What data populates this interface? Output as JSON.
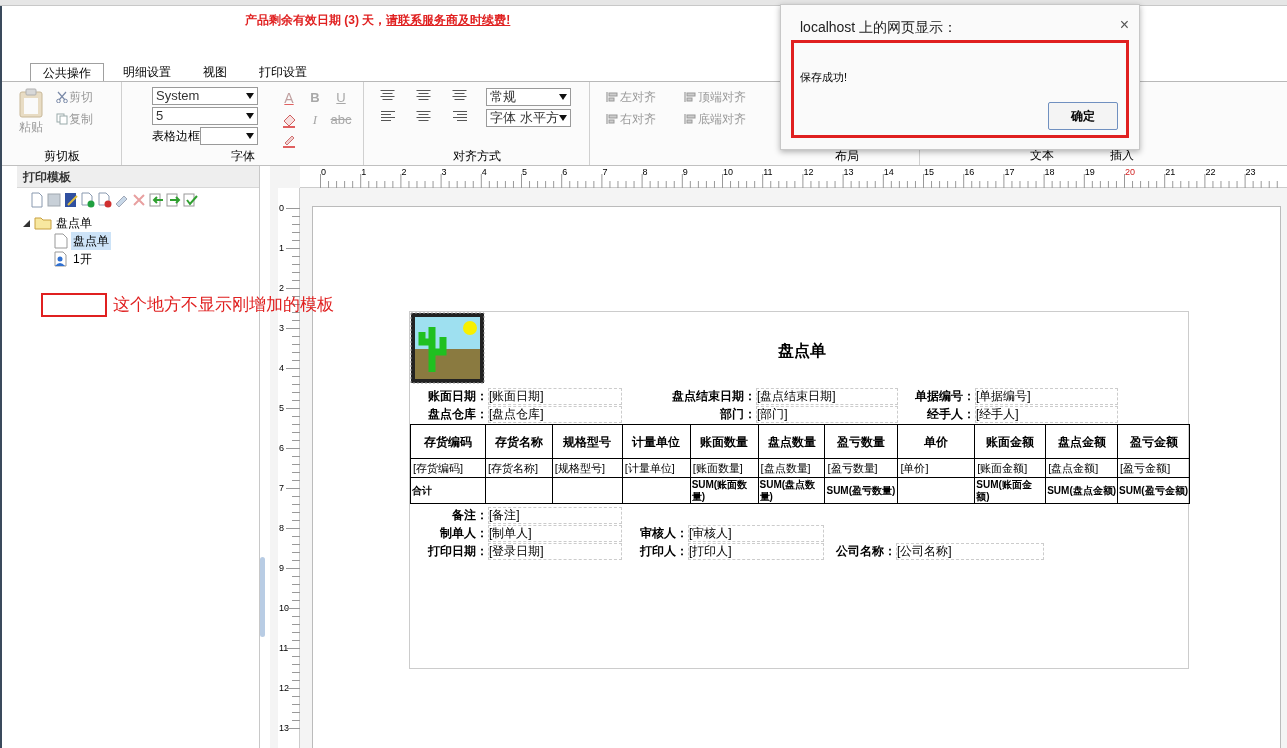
{
  "notice": {
    "text": "产品剩余有效日期 (3) 天，",
    "link": "请联系服务商及时续费!"
  },
  "ribbon": {
    "tabs": [
      {
        "label": "公共操作",
        "selected": true
      },
      {
        "label": "明细设置",
        "selected": false
      },
      {
        "label": "视图",
        "selected": false
      },
      {
        "label": "打印设置",
        "selected": false
      }
    ],
    "clipboard": {
      "label": "剪切板",
      "paste": {
        "label": "粘贴",
        "disabled": true
      },
      "buttons": [
        {
          "label": "剪切",
          "kind": "cut",
          "disabled": true
        },
        {
          "label": "复制",
          "kind": "copy",
          "disabled": true
        }
      ]
    },
    "font": {
      "label": "字体",
      "font_name": "System",
      "font_size": "5",
      "border_label": "表格边框",
      "style_buttons": [
        {
          "label": "B",
          "kind": "bold"
        },
        {
          "label": "U",
          "kind": "underline"
        },
        {
          "label": "I",
          "kind": "italic"
        },
        {
          "label": "abc",
          "kind": "strike"
        }
      ],
      "color_letter": "A"
    },
    "alignment": {
      "label": "对齐方式",
      "style": "常规",
      "direction": "字体 水平方"
    },
    "layout": {
      "label": "布局",
      "buttons": [
        {
          "label": "左对齐",
          "disabled": true
        },
        {
          "label": "顶端对齐",
          "disabled": true
        },
        {
          "label": "右对齐",
          "disabled": true
        },
        {
          "label": "底端对齐",
          "disabled": true
        }
      ]
    },
    "more_groups": [
      "文本",
      "插入"
    ]
  },
  "templates": {
    "title": "打印模板",
    "tree": [
      {
        "label": "盘点单",
        "expanded": true,
        "children": [
          {
            "label": "盘点单",
            "kind": "document",
            "selected": true
          },
          {
            "label": "1开",
            "kind": "user",
            "selected": false
          }
        ]
      }
    ]
  },
  "annotation": "这个地方不显示刚增加的模板",
  "rulers": {
    "horizontal": [
      "0",
      "1",
      "2",
      "3",
      "4",
      "5",
      "6",
      "7",
      "8",
      "9",
      "10",
      "11",
      "12",
      "13",
      "14",
      "15",
      "16",
      "17",
      "18",
      "19",
      "20",
      "21",
      "22",
      "23"
    ],
    "vertical": [
      "0",
      "1",
      "2",
      "3",
      "4",
      "5",
      "6",
      "7",
      "8",
      "9",
      "10",
      "11",
      "12",
      "13"
    ]
  },
  "report": {
    "title": "盘点单",
    "header_rows": [
      [
        {
          "label": "账面日期：",
          "value": "[账面日期]"
        },
        {
          "label": "盘点结束日期：",
          "value": "[盘点结束日期]"
        },
        {
          "label": "单据编号：",
          "value": "[单据编号]"
        }
      ],
      [
        {
          "label": "盘点仓库：",
          "value": "[盘点仓库]"
        },
        {
          "label": "部门：",
          "value": "[部门]"
        },
        {
          "label": "经手人：",
          "value": "[经手人]"
        }
      ]
    ],
    "columns": [
      "存货编码",
      "存货名称",
      "规格型号",
      "计量单位",
      "账面数量",
      "盘点数量",
      "盈亏数量",
      "单价",
      "账面金额",
      "盘点金额",
      "盈亏金额"
    ],
    "detail_row": [
      "[存货编码]",
      "[存货名称]",
      "[规格型号]",
      "[计量单位]",
      "[账面数量]",
      "[盘点数量]",
      "[盈亏数量]",
      "[单价]",
      "[账面金额]",
      "[盘点金额]",
      "[盈亏金额]"
    ],
    "total_row": {
      "label": "合计",
      "quantity_sums": [
        "SUM(账面数量)",
        "SUM(盘点数量)",
        "SUM(盈亏数量)"
      ],
      "amount_sums": [
        "SUM(账面金额)",
        "SUM(盘点金额)",
        "SUM(盈亏金额)"
      ]
    },
    "footer_rows": [
      [
        {
          "label": "备注：",
          "value": "[备注]"
        }
      ],
      [
        {
          "label": "制单人：",
          "value": "[制单人]"
        },
        {
          "label": "审核人：",
          "value": "[审核人]"
        }
      ],
      [
        {
          "label": "打印日期：",
          "value": "[登录日期]"
        },
        {
          "label": "打印人：",
          "value": "[打印人]"
        },
        {
          "label": "公司名称：",
          "value": "[公司名称]"
        }
      ]
    ]
  },
  "dialog": {
    "title": "localhost 上的网页显示：",
    "message": "保存成功!",
    "button": "确定",
    "close": "×"
  }
}
